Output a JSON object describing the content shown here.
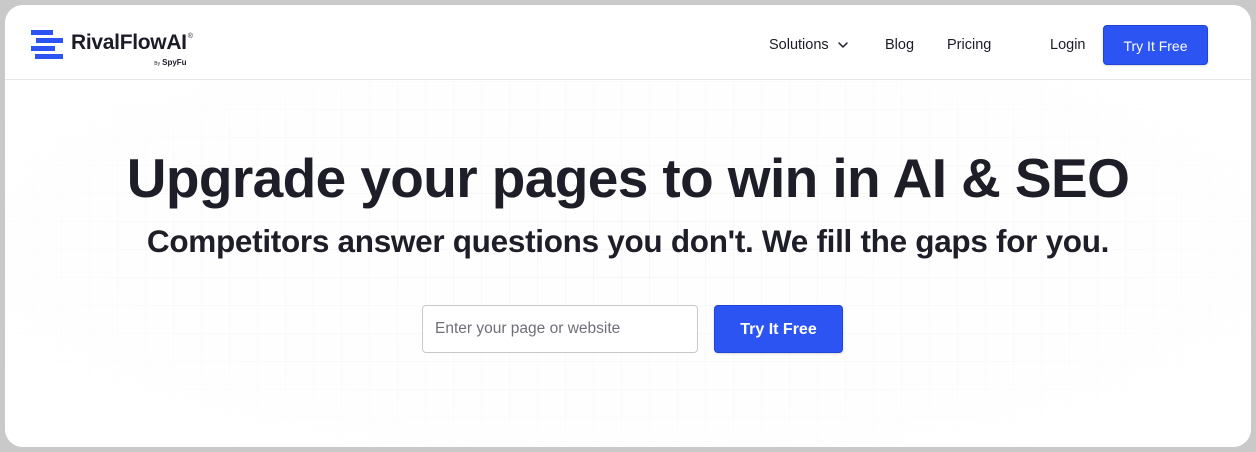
{
  "brand": {
    "name": "RivalFlowAI",
    "trademark": "®",
    "by_label": "By",
    "by_brand": "SpyFu"
  },
  "nav": {
    "items": [
      {
        "label": "Solutions",
        "has_dropdown": true
      },
      {
        "label": "Blog"
      },
      {
        "label": "Pricing"
      },
      {
        "label": "Login"
      }
    ],
    "cta_label": "Try It Free"
  },
  "hero": {
    "title": "Upgrade your pages to win in AI & SEO",
    "subtitle": "Competitors answer questions you don't. We fill the gaps for you.",
    "input_placeholder": "Enter your page or website",
    "input_value": "",
    "cta_label": "Try It Free"
  },
  "colors": {
    "accent": "#2b54f2",
    "text": "#1e1e28",
    "background": "#ffffff"
  },
  "icons": {
    "logo": "stacked-bars-logo-icon",
    "dropdown": "chevron-down-icon"
  }
}
